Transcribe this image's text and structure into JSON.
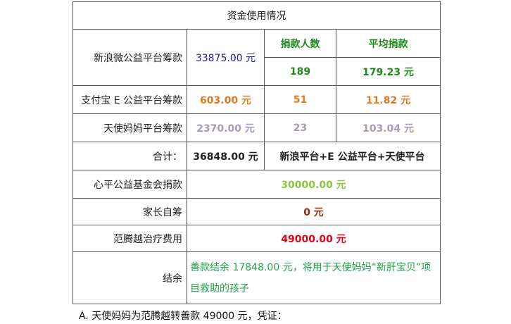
{
  "title": "资金使用情况",
  "rows": {
    "weibo": {
      "label": "新浪微公益平台筹款",
      "amount": "33875.00 元",
      "donors_header": "捐款人数",
      "avg_header": "平均捐款",
      "donors": "189",
      "avg": "179.23 元"
    },
    "alipay": {
      "label": "支付宝 E 公益平台筹款",
      "amount": "603.00 元",
      "donors": "51",
      "avg": "11.82 元"
    },
    "angel": {
      "label": "天使妈妈平台筹款",
      "amount": "2370.00 元",
      "donors": "23",
      "avg": "103.04 元"
    },
    "total": {
      "label": "合计：",
      "amount": "36848.00 元",
      "note": "新浪平台+E 公益平台+天使平台"
    },
    "xinping": {
      "label": "心平公益基金会捐款",
      "amount": "30000.00 元"
    },
    "parents": {
      "label": "家长自筹",
      "amount": "0 元"
    },
    "treatment": {
      "label": "范腾越治疗费用",
      "amount": "49000.00 元"
    },
    "balance": {
      "label": "结余",
      "note": "善款结余 17848.00 元，将用于天使妈妈“新肝宝贝”项目救助的孩子"
    }
  },
  "footer": "A. 天使妈妈为范腾越转善款 49000 元，凭证："
}
